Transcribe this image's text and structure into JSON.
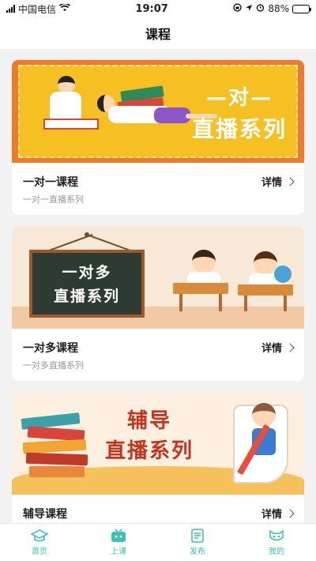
{
  "status_bar": {
    "carrier": "中国电信",
    "time": "19:07",
    "battery": "88%",
    "battery_level": 0.88
  },
  "nav": {
    "title": "课程"
  },
  "cards": [
    {
      "banner_line1": "—对—",
      "banner_line2": "直播系列",
      "title": "一对一课程",
      "subtitle": "一对一直播系列",
      "detail": "详情"
    },
    {
      "banner_line1": "一对多",
      "banner_line2": "直播系列",
      "title": "一对多课程",
      "subtitle": "一对多直播系列",
      "detail": "详情"
    },
    {
      "banner_line1": "辅导",
      "banner_line2": "直播系列",
      "title": "辅导课程",
      "subtitle": "",
      "detail": "详情"
    }
  ],
  "tabs": [
    {
      "label": "首页",
      "icon": "graduation-cap-icon"
    },
    {
      "label": "上课",
      "icon": "tv-icon"
    },
    {
      "label": "发布",
      "icon": "document-icon"
    },
    {
      "label": "我的",
      "icon": "mask-icon"
    }
  ],
  "colors": {
    "accent": "#3fc0b2",
    "banner1_border": "#ee7a2a",
    "banner1_fill": "#f6c023",
    "banner3_text": "#c7321d"
  }
}
